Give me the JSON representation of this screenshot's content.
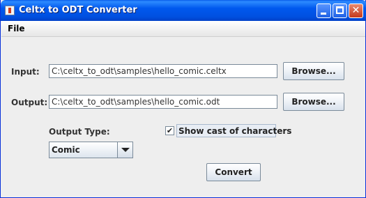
{
  "window": {
    "title": "Celtx to ODT Converter"
  },
  "menu": {
    "file": "File"
  },
  "input": {
    "label": "Input:",
    "value": "C:\\celtx_to_odt\\samples\\hello_comic.celtx",
    "browse": "Browse..."
  },
  "output": {
    "label": "Output:",
    "value": "C:\\celtx_to_odt\\samples\\hello_comic.odt",
    "browse": "Browse..."
  },
  "output_type": {
    "label": "Output Type:",
    "selected": "Comic"
  },
  "show_cast": {
    "label": "Show cast of characters",
    "checked": true,
    "check_glyph": "✔"
  },
  "convert": {
    "label": "Convert"
  },
  "colors": {
    "titlebar": "#0058EE",
    "background": "#EEEEEE",
    "accent": "#7A8A99"
  }
}
